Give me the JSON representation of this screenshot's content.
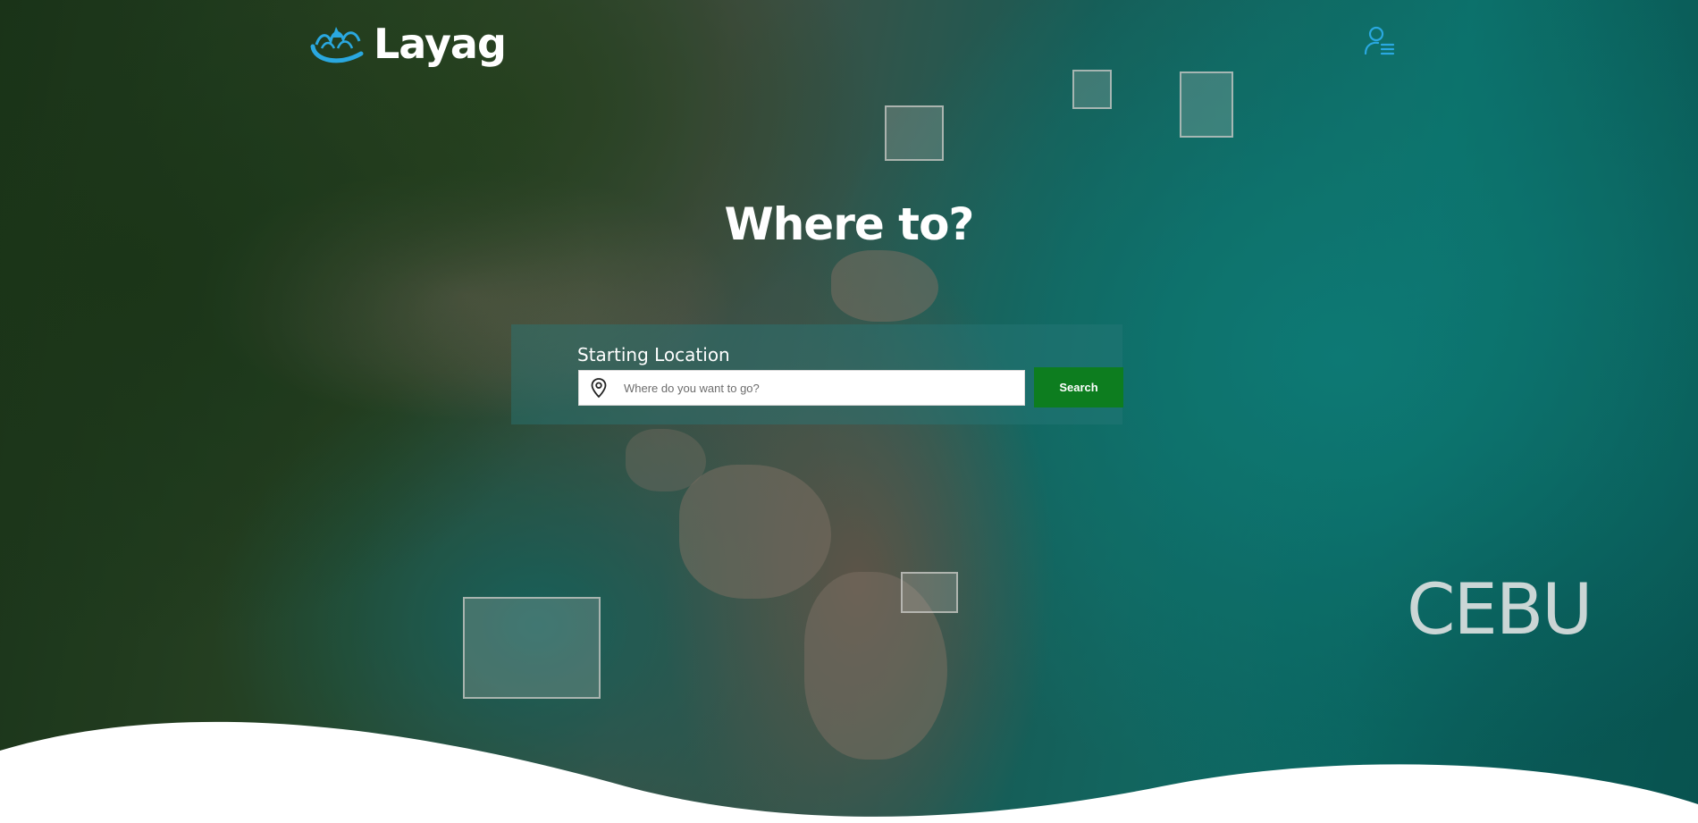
{
  "brand": {
    "name": "Layag",
    "icon": "wave-sail-logo-icon",
    "accent_color": "#2aa8e0"
  },
  "header": {
    "account_icon": "user-menu-icon"
  },
  "hero": {
    "headline": "Where to?",
    "city": "CEBU"
  },
  "search": {
    "label": "Starting Location",
    "placeholder": "Where do you want to go?",
    "value": "",
    "button_label": "Search",
    "button_color": "#0d7d1f",
    "location_icon": "map-pin-icon"
  }
}
